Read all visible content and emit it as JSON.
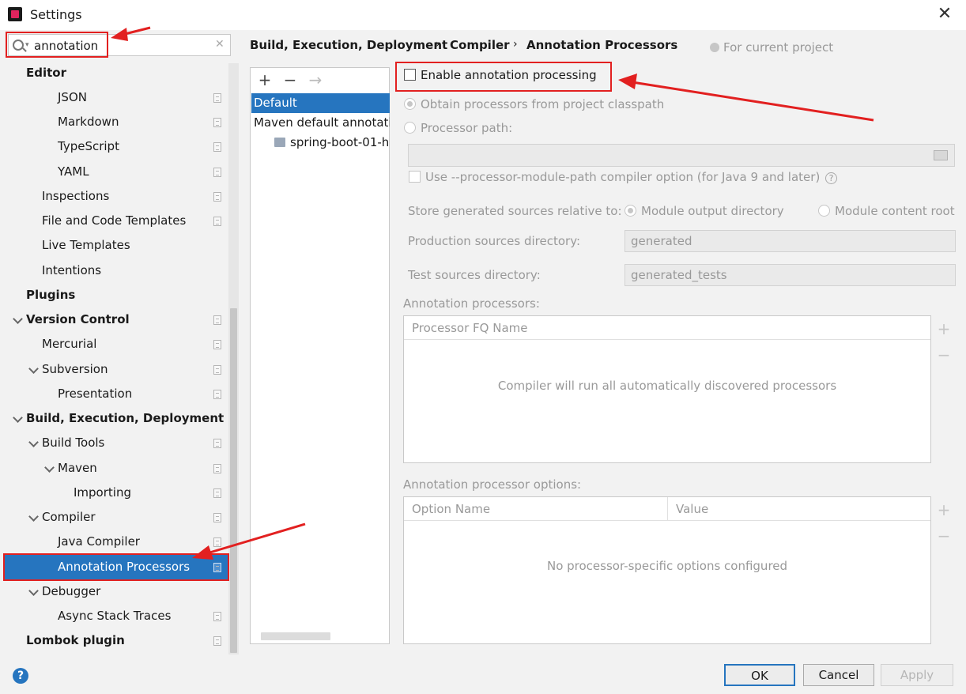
{
  "window": {
    "title": "Settings",
    "close_label": "✕"
  },
  "search": {
    "value": "annotation"
  },
  "tree": [
    {
      "label": "Editor"
    },
    {
      "label": "JSON"
    },
    {
      "label": "Markdown"
    },
    {
      "label": "TypeScript"
    },
    {
      "label": "YAML"
    },
    {
      "label": "Inspections"
    },
    {
      "label": "File and Code Templates"
    },
    {
      "label": "Live Templates"
    },
    {
      "label": "Intentions"
    },
    {
      "label": "Plugins"
    },
    {
      "label": "Version Control"
    },
    {
      "label": "Mercurial"
    },
    {
      "label": "Subversion"
    },
    {
      "label": "Presentation"
    },
    {
      "label": "Build, Execution, Deployment"
    },
    {
      "label": "Build Tools"
    },
    {
      "label": "Maven"
    },
    {
      "label": "Importing"
    },
    {
      "label": "Compiler"
    },
    {
      "label": "Java Compiler"
    },
    {
      "label": "Annotation Processors"
    },
    {
      "label": "Debugger"
    },
    {
      "label": "Async Stack Traces"
    },
    {
      "label": "Lombok plugin"
    }
  ],
  "breadcrumb": [
    "Build, Execution, Deployment",
    "Compiler",
    "Annotation Processors"
  ],
  "for_current_project": "For current project",
  "profiles": {
    "toolbar": {
      "add": "+",
      "remove": "−",
      "move": "→"
    },
    "items": [
      "Default",
      "Maven default annotatio",
      "spring-boot-01-h"
    ]
  },
  "settings": {
    "enable_label": "Enable annotation processing",
    "obtain_label": "Obtain processors from project classpath",
    "processor_path_label": "Processor path:",
    "module_path_label": "Use --processor-module-path compiler option (for Java 9 and later)",
    "store_label": "Store generated sources relative to:",
    "module_output": "Module output directory",
    "module_content": "Module content root",
    "prod_label": "Production sources directory:",
    "prod_value": "generated",
    "test_label": "Test sources directory:",
    "test_value": "generated_tests",
    "processors_label": "Annotation processors:",
    "processors_header": "Processor FQ Name",
    "processors_empty": "Compiler will run all automatically discovered processors",
    "options_label": "Annotation processor options:",
    "options_col1": "Option Name",
    "options_col2": "Value",
    "options_empty": "No processor-specific options configured",
    "plus": "+",
    "minus": "−"
  },
  "buttons": {
    "ok": "OK",
    "cancel": "Cancel",
    "apply": "Apply",
    "help": "?"
  },
  "colors": {
    "accent": "#2675bf",
    "annotation_red": "#e22020"
  }
}
